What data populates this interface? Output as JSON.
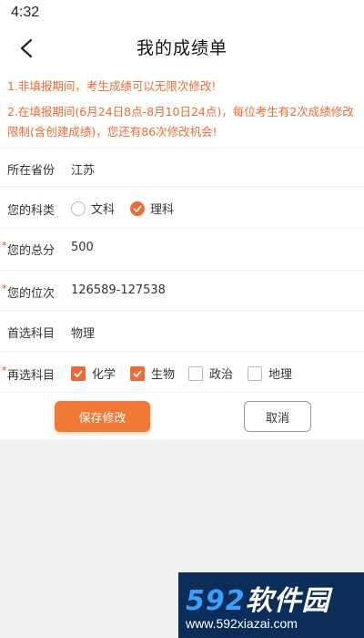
{
  "status_bar": {
    "time": "4:32"
  },
  "header": {
    "title": "我的成绩单",
    "back_icon": "chevron-left-icon"
  },
  "notices": [
    "1.非填报期间，考生成绩可以无限次修改!",
    "2.在填报期间(6月24日8点-8月10日24点)，每位考生有2次成绩修改限制(含创建成绩)，您还有86次修改机会!"
  ],
  "form": {
    "province": {
      "label": "所在省份",
      "value": "江苏"
    },
    "subject_type": {
      "label": "您的科类",
      "options": [
        {
          "label": "文科",
          "selected": false
        },
        {
          "label": "理科",
          "selected": true
        }
      ]
    },
    "total_score": {
      "label": "您的总分",
      "value": "500",
      "required": true
    },
    "rank": {
      "label": "您的位次",
      "value": "126589-127538",
      "required": true
    },
    "first_choice": {
      "label": "首选科目",
      "value": "物理"
    },
    "second_choice": {
      "label": "再选科目",
      "required": true,
      "options": [
        {
          "label": "化学",
          "checked": true
        },
        {
          "label": "生物",
          "checked": true
        },
        {
          "label": "政治",
          "checked": false
        },
        {
          "label": "地理",
          "checked": false
        }
      ]
    }
  },
  "buttons": {
    "save": "保存修改",
    "cancel": "取消"
  },
  "watermark": {
    "brand_num": "592",
    "brand_text": "软件园",
    "url": "www.592xiazai.com"
  },
  "colors": {
    "accent": "#ee6b33",
    "required_star": "#e0412b",
    "watermark_bg": "#0b2d5a"
  }
}
